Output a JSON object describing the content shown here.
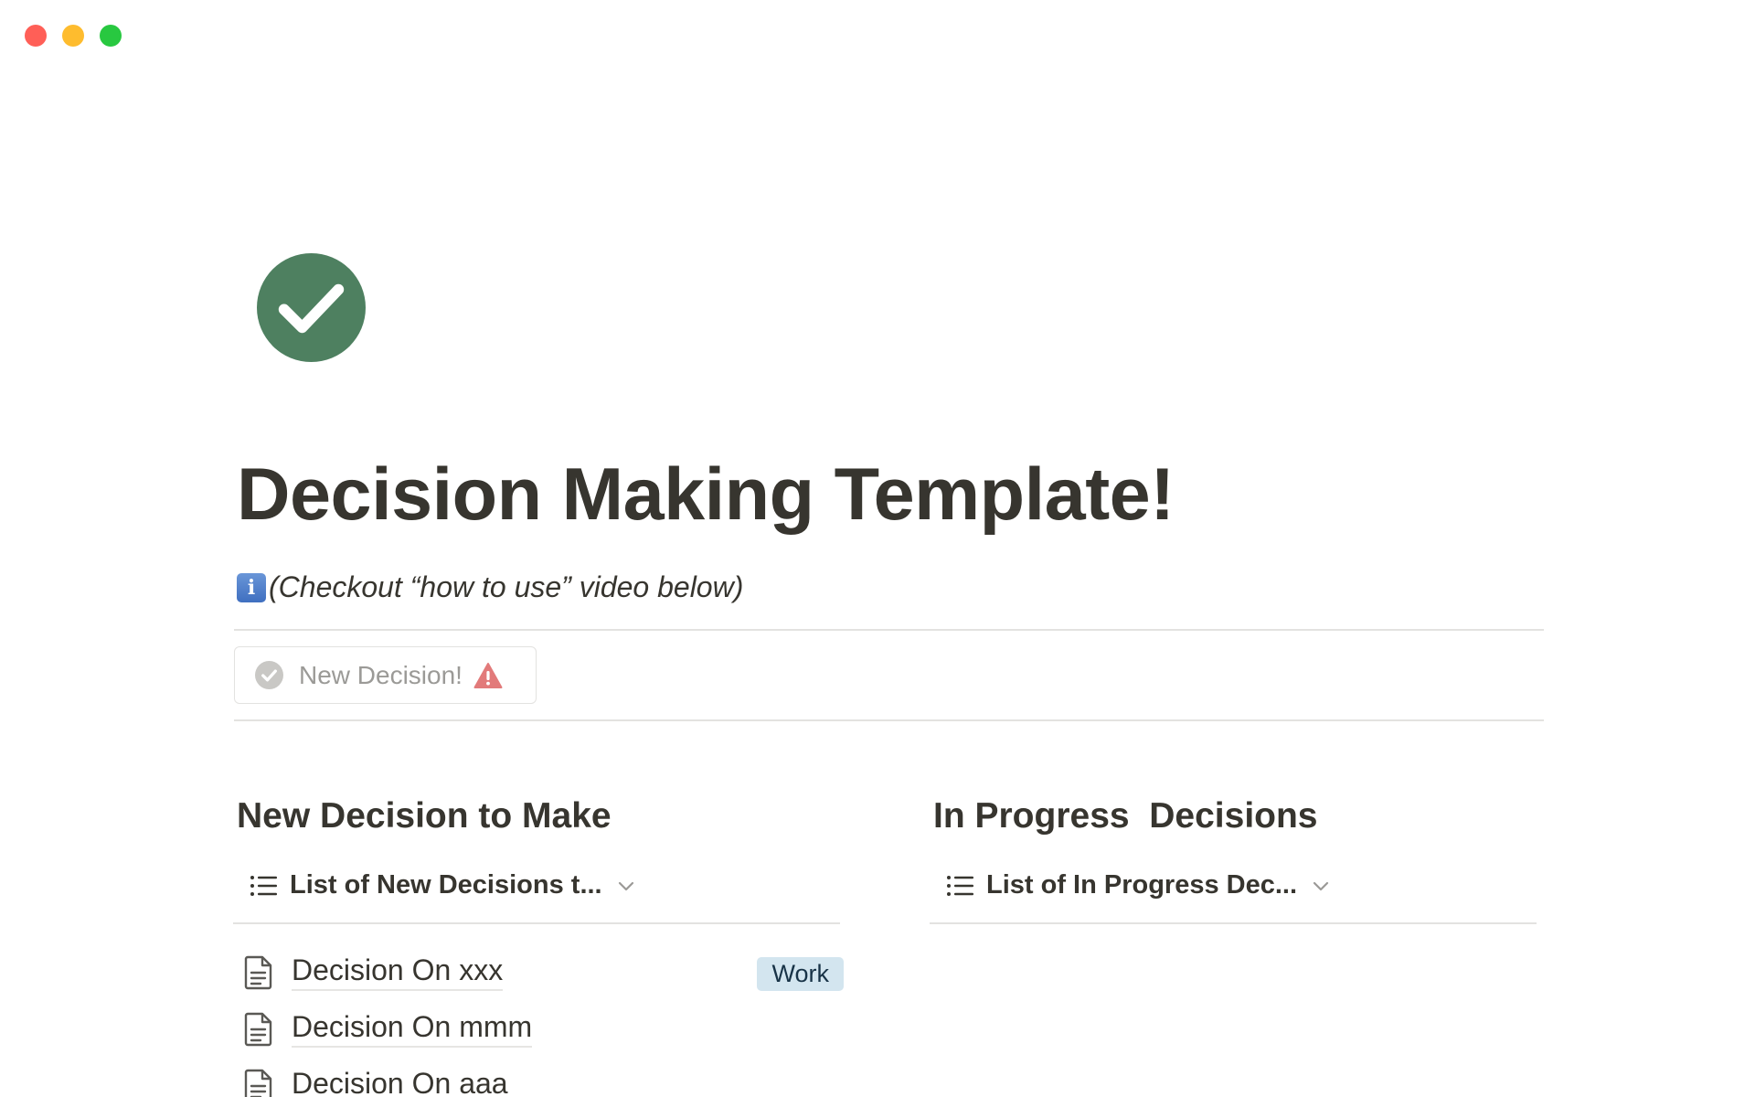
{
  "window": {
    "controls": [
      "close",
      "minimize",
      "maximize"
    ]
  },
  "page": {
    "icon": "check-circle-icon",
    "icon_color": "#4e8060",
    "title": "Decision Making Template!",
    "subtitle": "(Checkout “how to use” video below)",
    "subtitle_icon_text": "i"
  },
  "button": {
    "label": "New Decision!",
    "icon": "check-circle-icon",
    "trailing_icon": "warning-icon"
  },
  "columns": {
    "left": {
      "heading": "New Decision to Make",
      "view_label": "List of New Decisions t...",
      "rows": [
        {
          "title": "Decision On xxx",
          "tag": "Work"
        },
        {
          "title": "Decision On mmm",
          "tag": ""
        },
        {
          "title": "Decision On aaa",
          "tag": ""
        }
      ]
    },
    "right": {
      "heading": "In Progress  Decisions",
      "view_label": "List of In Progress Dec...",
      "rows": []
    }
  },
  "colors": {
    "text": "#37352f",
    "muted": "#9b9a97",
    "divider": "#e3e2e0",
    "tag_bg": "#d3e5ef",
    "tag_text": "#183347",
    "warning": "#e27a7a"
  }
}
